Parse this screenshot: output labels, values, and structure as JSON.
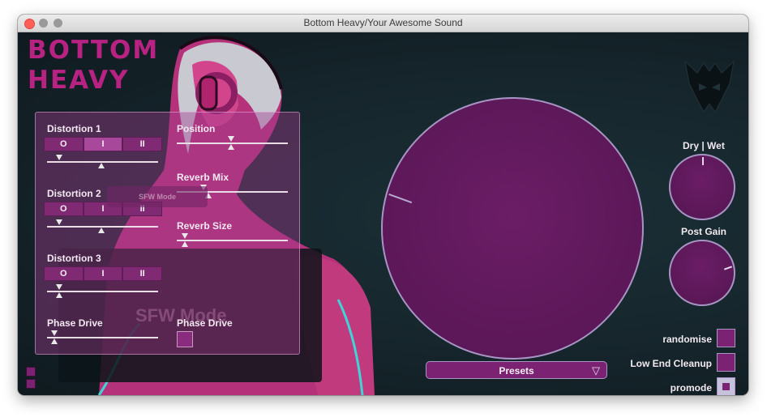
{
  "window": {
    "title": "Bottom Heavy/Your Awesome Sound"
  },
  "logo": {
    "line1": "BOTTOM",
    "line2": "HEAVY"
  },
  "colors": {
    "accent": "#b82282",
    "panel": "#7b2372",
    "ring": "#a795c4",
    "background": "#132127"
  },
  "left_panel": {
    "distortion1": {
      "label": "Distortion 1",
      "options": [
        "O",
        "I",
        "II"
      ],
      "selected": "I",
      "level": 0.45
    },
    "distortion2": {
      "label": "Distortion 2",
      "options": [
        "O",
        "I",
        "II"
      ],
      "selected": "",
      "level": 0.45
    },
    "distortion3": {
      "label": "Distortion 3",
      "options": [
        "O",
        "I",
        "II"
      ],
      "selected": "",
      "level": 0.1
    },
    "position": {
      "label": "Position",
      "level": 0.5
    },
    "reverb_mix": {
      "label": "Reverb Mix",
      "level": 0.25
    },
    "reverb_size": {
      "label": "Reverb Size",
      "level": 0.07
    },
    "phase_drive_slider": {
      "label": "Phase Drive",
      "level": 0.06
    },
    "phase_drive_toggle": {
      "label": "Phase Drive"
    },
    "sfw_overlay_label": "SFW Mode"
  },
  "sfw_background_text": "SFW Mode",
  "knobs": {
    "dry_wet": {
      "label": "Dry | Wet"
    },
    "post_gain": {
      "label": "Post Gain"
    }
  },
  "presets": {
    "label": "Presets",
    "icon": "triangle-down-icon"
  },
  "options": {
    "randomise": {
      "label": "randomise",
      "checked": false
    },
    "low_end_cleanup": {
      "label": "Low End Cleanup",
      "checked": false
    },
    "promode": {
      "label": "promode",
      "checked": true
    }
  }
}
